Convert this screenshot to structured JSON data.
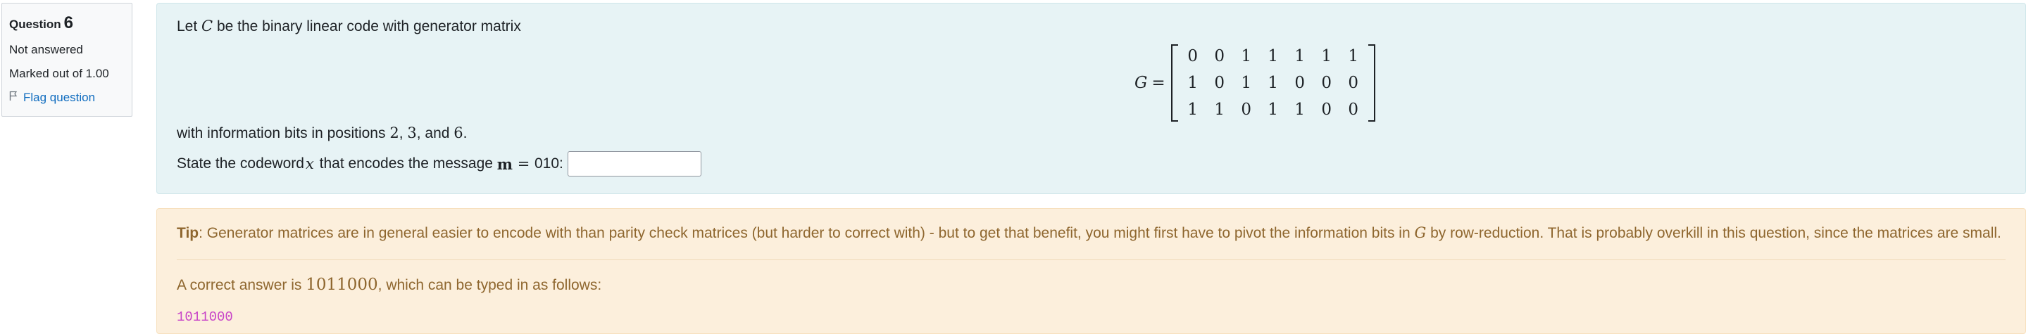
{
  "info": {
    "question_label": "Question",
    "question_number": "6",
    "status": "Not answered",
    "marks": "Marked out of 1.00",
    "flag_label": "Flag question"
  },
  "question": {
    "intro_pre": "Let ",
    "code_symbol": "C",
    "intro_post": " be the binary linear code with generator matrix",
    "matrix_name": "G",
    "equals": "=",
    "matrix": [
      [
        "0",
        "0",
        "1",
        "1",
        "1",
        "1",
        "1"
      ],
      [
        "1",
        "0",
        "1",
        "1",
        "0",
        "0",
        "0"
      ],
      [
        "1",
        "1",
        "0",
        "1",
        "1",
        "0",
        "0"
      ]
    ],
    "info_bits_pre": "with information bits in positions ",
    "pos1": "2",
    "sep1": ", ",
    "pos2": "3",
    "sep2": ", and ",
    "pos3": "6",
    "info_bits_post": ".",
    "state_pre": "State the codeword ",
    "codeword_var": "x",
    "state_mid": " that encodes the message ",
    "message_var": "m",
    "message_eq": " = ",
    "message_value": "010:",
    "answer_value": ""
  },
  "feedback": {
    "tip_label": "Tip",
    "tip_pre": ": Generator matrices are in general easier to encode with than parity check matrices (but harder to correct with) - but to get that benefit, you might first have to pivot the information bits in ",
    "tip_matrix": "G",
    "tip_post": " by row-reduction. That is probably overkill in this question, since the matrices are small.",
    "correct_pre": "A correct answer is ",
    "correct_value": "1011000",
    "correct_post": ", which can be typed in as follows:",
    "typed_answer": "1011000"
  }
}
